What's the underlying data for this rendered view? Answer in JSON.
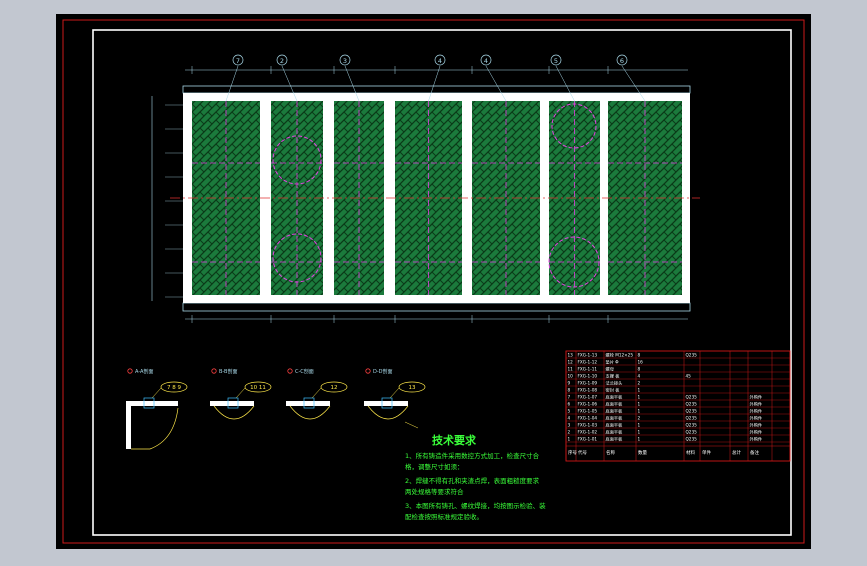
{
  "colors": {
    "background": "#c2c7d0",
    "sheet": "#000000",
    "border_red": "#cc1a1a",
    "frame_white": "#ffffff",
    "plan_green": "#1b7a3c",
    "hatch_dark": "#0a3a18",
    "magenta": "#e040e0",
    "cyan_dim": "#a8d8e8",
    "yellow": "#ffe84a",
    "text_green": "#3aff3a",
    "title_red": "#d01818"
  },
  "callouts": [
    "7",
    "2",
    "3",
    "4",
    "4",
    "5",
    "6"
  ],
  "section_labels": [
    "A-A剖面",
    "B-B剖面",
    "C-C剖面",
    "D-D剖面"
  ],
  "section_balloons": [
    "7 8 9",
    "10 11",
    "12",
    "13"
  ],
  "tech": {
    "title": "技术要求",
    "lines": [
      "1、所有铸造件采用数控方式加工，检查尺寸合",
      "   格，调整尺寸如须：",
      "2、焊缝不得有孔和夹渣点焊，表面粗糙度要求",
      "   两处规格等要求符合",
      "3、本图所有铸孔、螺纹焊接，均按图示检验、装",
      "   配检查按照标准规定验收。"
    ]
  },
  "bom_header": [
    "序号",
    "代号",
    "名称",
    "数量",
    "材料",
    "单件",
    "总计",
    "备注"
  ],
  "bom_rows": [
    [
      "13",
      "FXG-1-13",
      "螺栓 M12×25",
      "8",
      "Q235",
      "",
      "",
      ""
    ],
    [
      "12",
      "FXG-1-12",
      "垫片 Φ",
      "16",
      "",
      "",
      "",
      ""
    ],
    [
      "11",
      "FXG-1-11",
      "螺母",
      "8",
      "",
      "",
      "",
      ""
    ],
    [
      "10",
      "FXG-1-10",
      "支撑 板",
      "4",
      "45",
      "",
      "",
      ""
    ],
    [
      "9",
      "FXG-1-09",
      "法兰接头",
      "2",
      "",
      "",
      "",
      ""
    ],
    [
      "8",
      "FXG-1-08",
      "密封 板",
      "1",
      "",
      "",
      "",
      ""
    ],
    [
      "7",
      "FXG-1-07",
      "底面平板",
      "1",
      "Q235",
      "",
      "",
      "外购件"
    ],
    [
      "6",
      "FXG-1-06",
      "底面平板",
      "1",
      "Q235",
      "",
      "",
      "外购件"
    ],
    [
      "5",
      "FXG-1-05",
      "底面平板",
      "1",
      "Q235",
      "",
      "",
      "外购件"
    ],
    [
      "4",
      "FXG-1-04",
      "底面平板",
      "2",
      "Q235",
      "",
      "",
      "外购件"
    ],
    [
      "3",
      "FXG-1-03",
      "底面平板",
      "1",
      "Q235",
      "",
      "",
      "外购件"
    ],
    [
      "2",
      "FXG-1-02",
      "底面平板",
      "1",
      "Q235",
      "",
      "",
      "外购件"
    ],
    [
      "1",
      "FXG-1-01",
      "底面平板",
      "1",
      "Q235",
      "",
      "",
      "外购件"
    ]
  ]
}
